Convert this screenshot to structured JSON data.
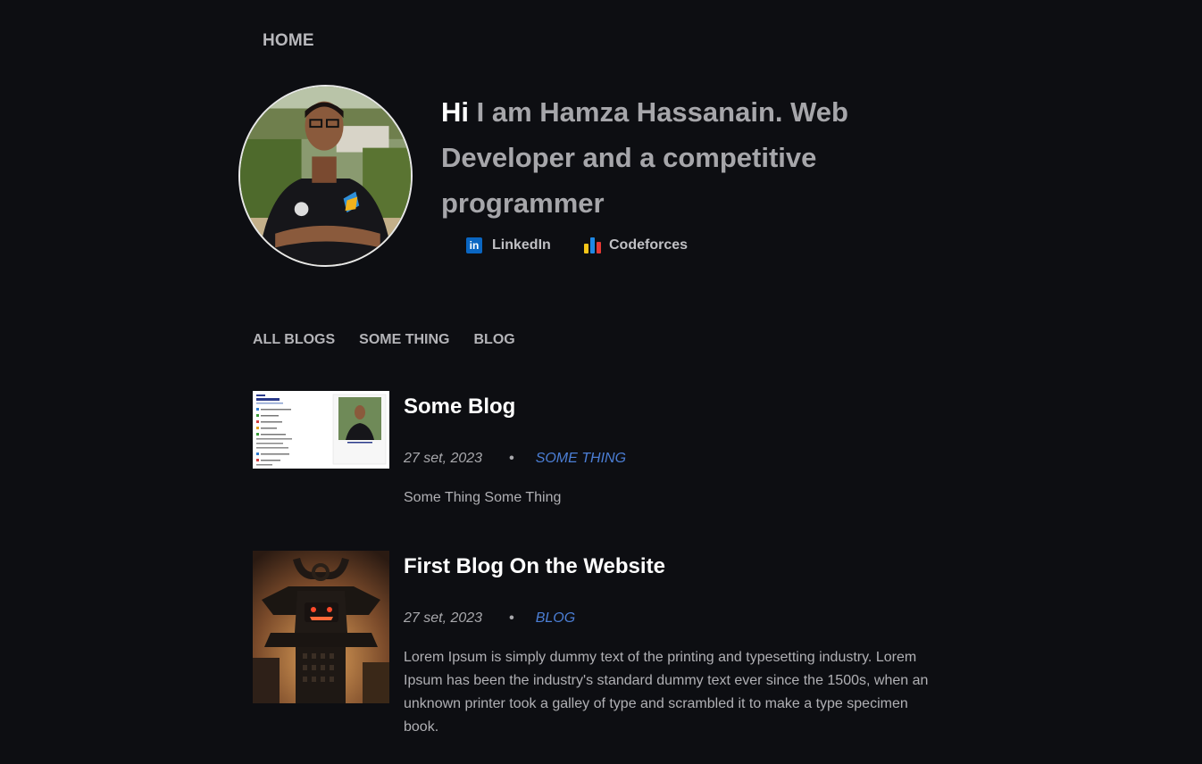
{
  "nav": {
    "home_label": "HOME"
  },
  "profile": {
    "greeting": "Hi",
    "intro": " I am Hamza Hassanain. Web Developer and a competitive programmer",
    "links": [
      {
        "label": "LinkedIn",
        "icon": "linkedin-icon",
        "icon_glyph": "in"
      },
      {
        "label": "Codeforces",
        "icon": "codeforces-icon"
      }
    ]
  },
  "tabs": [
    "ALL BLOGS",
    "SOME THING",
    "BLOG"
  ],
  "posts": [
    {
      "title": "Some Blog",
      "date": "27 set, 2023",
      "separator": "•",
      "category": "SOME THING",
      "excerpt": "Some Thing Some Thing"
    },
    {
      "title": "First Blog On the Website",
      "date": "27 set, 2023",
      "separator": "•",
      "category": "BLOG",
      "excerpt": "Lorem Ipsum is simply dummy text of the printing and typesetting industry. Lorem Ipsum has been the industry's standard dummy text ever since the 1500s, when an unknown printer took a galley of type and scrambled it to make a type specimen book."
    }
  ],
  "colors": {
    "background": "#0d0e12",
    "accent": "#4c7fd6",
    "linkedin": "#0a66c2",
    "codeforces_bars": [
      "#f5c518",
      "#1e88e5",
      "#e53935"
    ]
  }
}
